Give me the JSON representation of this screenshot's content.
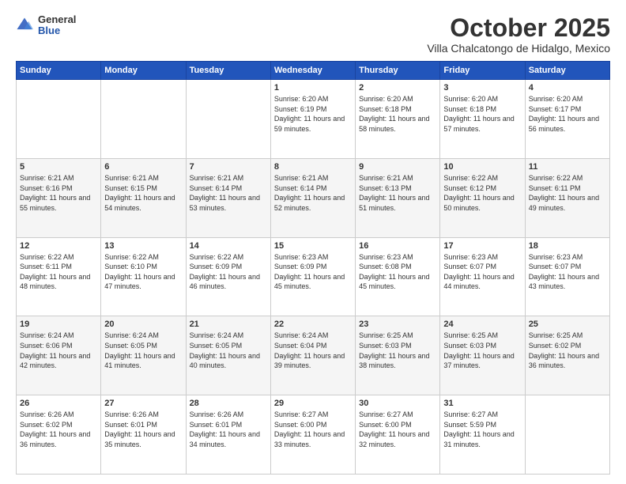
{
  "header": {
    "logo": {
      "general": "General",
      "blue": "Blue"
    },
    "month": "October 2025",
    "location": "Villa Chalcatongo de Hidalgo, Mexico"
  },
  "weekdays": [
    "Sunday",
    "Monday",
    "Tuesday",
    "Wednesday",
    "Thursday",
    "Friday",
    "Saturday"
  ],
  "weeks": [
    [
      {
        "day": "",
        "sunrise": "",
        "sunset": "",
        "daylight": ""
      },
      {
        "day": "",
        "sunrise": "",
        "sunset": "",
        "daylight": ""
      },
      {
        "day": "",
        "sunrise": "",
        "sunset": "",
        "daylight": ""
      },
      {
        "day": "1",
        "sunrise": "Sunrise: 6:20 AM",
        "sunset": "Sunset: 6:19 PM",
        "daylight": "Daylight: 11 hours and 59 minutes."
      },
      {
        "day": "2",
        "sunrise": "Sunrise: 6:20 AM",
        "sunset": "Sunset: 6:18 PM",
        "daylight": "Daylight: 11 hours and 58 minutes."
      },
      {
        "day": "3",
        "sunrise": "Sunrise: 6:20 AM",
        "sunset": "Sunset: 6:18 PM",
        "daylight": "Daylight: 11 hours and 57 minutes."
      },
      {
        "day": "4",
        "sunrise": "Sunrise: 6:20 AM",
        "sunset": "Sunset: 6:17 PM",
        "daylight": "Daylight: 11 hours and 56 minutes."
      }
    ],
    [
      {
        "day": "5",
        "sunrise": "Sunrise: 6:21 AM",
        "sunset": "Sunset: 6:16 PM",
        "daylight": "Daylight: 11 hours and 55 minutes."
      },
      {
        "day": "6",
        "sunrise": "Sunrise: 6:21 AM",
        "sunset": "Sunset: 6:15 PM",
        "daylight": "Daylight: 11 hours and 54 minutes."
      },
      {
        "day": "7",
        "sunrise": "Sunrise: 6:21 AM",
        "sunset": "Sunset: 6:14 PM",
        "daylight": "Daylight: 11 hours and 53 minutes."
      },
      {
        "day": "8",
        "sunrise": "Sunrise: 6:21 AM",
        "sunset": "Sunset: 6:14 PM",
        "daylight": "Daylight: 11 hours and 52 minutes."
      },
      {
        "day": "9",
        "sunrise": "Sunrise: 6:21 AM",
        "sunset": "Sunset: 6:13 PM",
        "daylight": "Daylight: 11 hours and 51 minutes."
      },
      {
        "day": "10",
        "sunrise": "Sunrise: 6:22 AM",
        "sunset": "Sunset: 6:12 PM",
        "daylight": "Daylight: 11 hours and 50 minutes."
      },
      {
        "day": "11",
        "sunrise": "Sunrise: 6:22 AM",
        "sunset": "Sunset: 6:11 PM",
        "daylight": "Daylight: 11 hours and 49 minutes."
      }
    ],
    [
      {
        "day": "12",
        "sunrise": "Sunrise: 6:22 AM",
        "sunset": "Sunset: 6:11 PM",
        "daylight": "Daylight: 11 hours and 48 minutes."
      },
      {
        "day": "13",
        "sunrise": "Sunrise: 6:22 AM",
        "sunset": "Sunset: 6:10 PM",
        "daylight": "Daylight: 11 hours and 47 minutes."
      },
      {
        "day": "14",
        "sunrise": "Sunrise: 6:22 AM",
        "sunset": "Sunset: 6:09 PM",
        "daylight": "Daylight: 11 hours and 46 minutes."
      },
      {
        "day": "15",
        "sunrise": "Sunrise: 6:23 AM",
        "sunset": "Sunset: 6:09 PM",
        "daylight": "Daylight: 11 hours and 45 minutes."
      },
      {
        "day": "16",
        "sunrise": "Sunrise: 6:23 AM",
        "sunset": "Sunset: 6:08 PM",
        "daylight": "Daylight: 11 hours and 45 minutes."
      },
      {
        "day": "17",
        "sunrise": "Sunrise: 6:23 AM",
        "sunset": "Sunset: 6:07 PM",
        "daylight": "Daylight: 11 hours and 44 minutes."
      },
      {
        "day": "18",
        "sunrise": "Sunrise: 6:23 AM",
        "sunset": "Sunset: 6:07 PM",
        "daylight": "Daylight: 11 hours and 43 minutes."
      }
    ],
    [
      {
        "day": "19",
        "sunrise": "Sunrise: 6:24 AM",
        "sunset": "Sunset: 6:06 PM",
        "daylight": "Daylight: 11 hours and 42 minutes."
      },
      {
        "day": "20",
        "sunrise": "Sunrise: 6:24 AM",
        "sunset": "Sunset: 6:05 PM",
        "daylight": "Daylight: 11 hours and 41 minutes."
      },
      {
        "day": "21",
        "sunrise": "Sunrise: 6:24 AM",
        "sunset": "Sunset: 6:05 PM",
        "daylight": "Daylight: 11 hours and 40 minutes."
      },
      {
        "day": "22",
        "sunrise": "Sunrise: 6:24 AM",
        "sunset": "Sunset: 6:04 PM",
        "daylight": "Daylight: 11 hours and 39 minutes."
      },
      {
        "day": "23",
        "sunrise": "Sunrise: 6:25 AM",
        "sunset": "Sunset: 6:03 PM",
        "daylight": "Daylight: 11 hours and 38 minutes."
      },
      {
        "day": "24",
        "sunrise": "Sunrise: 6:25 AM",
        "sunset": "Sunset: 6:03 PM",
        "daylight": "Daylight: 11 hours and 37 minutes."
      },
      {
        "day": "25",
        "sunrise": "Sunrise: 6:25 AM",
        "sunset": "Sunset: 6:02 PM",
        "daylight": "Daylight: 11 hours and 36 minutes."
      }
    ],
    [
      {
        "day": "26",
        "sunrise": "Sunrise: 6:26 AM",
        "sunset": "Sunset: 6:02 PM",
        "daylight": "Daylight: 11 hours and 36 minutes."
      },
      {
        "day": "27",
        "sunrise": "Sunrise: 6:26 AM",
        "sunset": "Sunset: 6:01 PM",
        "daylight": "Daylight: 11 hours and 35 minutes."
      },
      {
        "day": "28",
        "sunrise": "Sunrise: 6:26 AM",
        "sunset": "Sunset: 6:01 PM",
        "daylight": "Daylight: 11 hours and 34 minutes."
      },
      {
        "day": "29",
        "sunrise": "Sunrise: 6:27 AM",
        "sunset": "Sunset: 6:00 PM",
        "daylight": "Daylight: 11 hours and 33 minutes."
      },
      {
        "day": "30",
        "sunrise": "Sunrise: 6:27 AM",
        "sunset": "Sunset: 6:00 PM",
        "daylight": "Daylight: 11 hours and 32 minutes."
      },
      {
        "day": "31",
        "sunrise": "Sunrise: 6:27 AM",
        "sunset": "Sunset: 5:59 PM",
        "daylight": "Daylight: 11 hours and 31 minutes."
      },
      {
        "day": "",
        "sunrise": "",
        "sunset": "",
        "daylight": ""
      }
    ]
  ]
}
